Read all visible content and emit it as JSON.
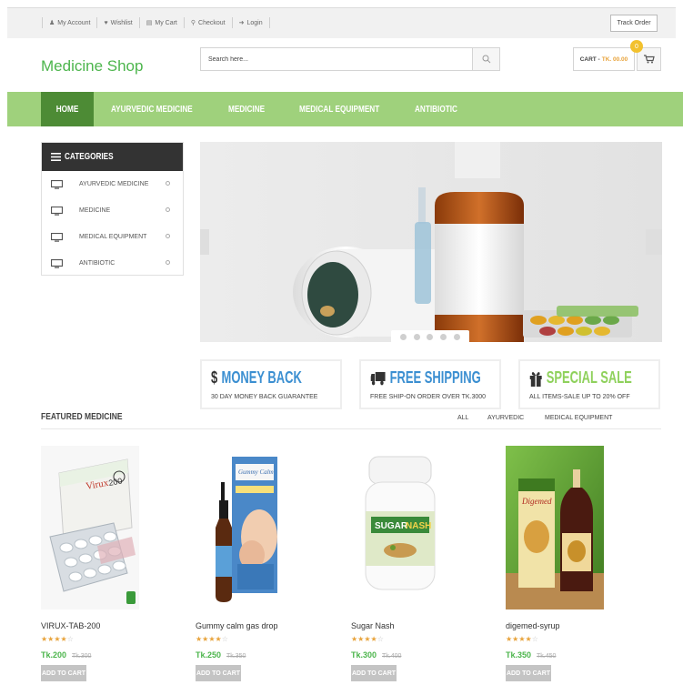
{
  "topbar": {
    "links": [
      {
        "label": "My Account",
        "icon": "user-icon"
      },
      {
        "label": "Wishlist",
        "icon": "heart-icon"
      },
      {
        "label": "My Cart",
        "icon": "cart-icon"
      },
      {
        "label": "Checkout",
        "icon": "key-icon"
      },
      {
        "label": "Login",
        "icon": "login-icon"
      }
    ],
    "track_order": "Track Order"
  },
  "header": {
    "logo": "Medicine Shop",
    "search_placeholder": "Search here...",
    "cart_label": "CART -",
    "cart_amount": "TK. 00.00",
    "cart_count": "0"
  },
  "nav": {
    "items": [
      "HOME",
      "AYURVEDIC MEDICINE",
      "MEDICINE",
      "MEDICAL EQUIPMENT",
      "ANTIBIOTIC"
    ]
  },
  "categories": {
    "title": "CATEGORIES",
    "items": [
      "AYURVEDIC MEDICINE",
      "MEDICINE",
      "MEDICAL EQUIPMENT",
      "ANTIBIOTIC"
    ]
  },
  "features": [
    {
      "title": "MONEY BACK",
      "subtitle": "30 DAY MONEY BACK GUARANTEE",
      "icon": "dollar-icon"
    },
    {
      "title": "FREE SHIPPING",
      "subtitle": "FREE SHIP-ON ORDER OVER TK.3000",
      "icon": "truck-icon"
    },
    {
      "title": "SPECIAL SALE",
      "subtitle": "ALL ITEMS-SALE UP TO 20% OFF",
      "icon": "gift-icon"
    }
  ],
  "featured": {
    "title": "FEATURED MEDICINE",
    "tabs": [
      "ALL",
      "AYURVEDIC",
      "MEDICAL EQUIPMENT"
    ]
  },
  "products": [
    {
      "name": "VIRUX-TAB-200",
      "price": "Tk.200",
      "old_price": "Tk.300",
      "rating": 4,
      "add": "ADD TO CART"
    },
    {
      "name": "Gummy calm gas drop",
      "price": "Tk.250",
      "old_price": "Tk.350",
      "rating": 4,
      "add": "ADD TO CART"
    },
    {
      "name": "Sugar Nash",
      "price": "Tk.300",
      "old_price": "Tk.400",
      "rating": 4,
      "add": "ADD TO CART"
    },
    {
      "name": "digemed-syrup",
      "price": "Tk.350",
      "old_price": "Tk.450",
      "rating": 4,
      "add": "ADD TO CART"
    }
  ],
  "colors": {
    "brand_green": "#4cb54c",
    "nav_green": "#9fd17c",
    "home_green": "#4d8b35",
    "accent_orange": "#e8a33b",
    "feature_blue": "#3b8fd1"
  }
}
